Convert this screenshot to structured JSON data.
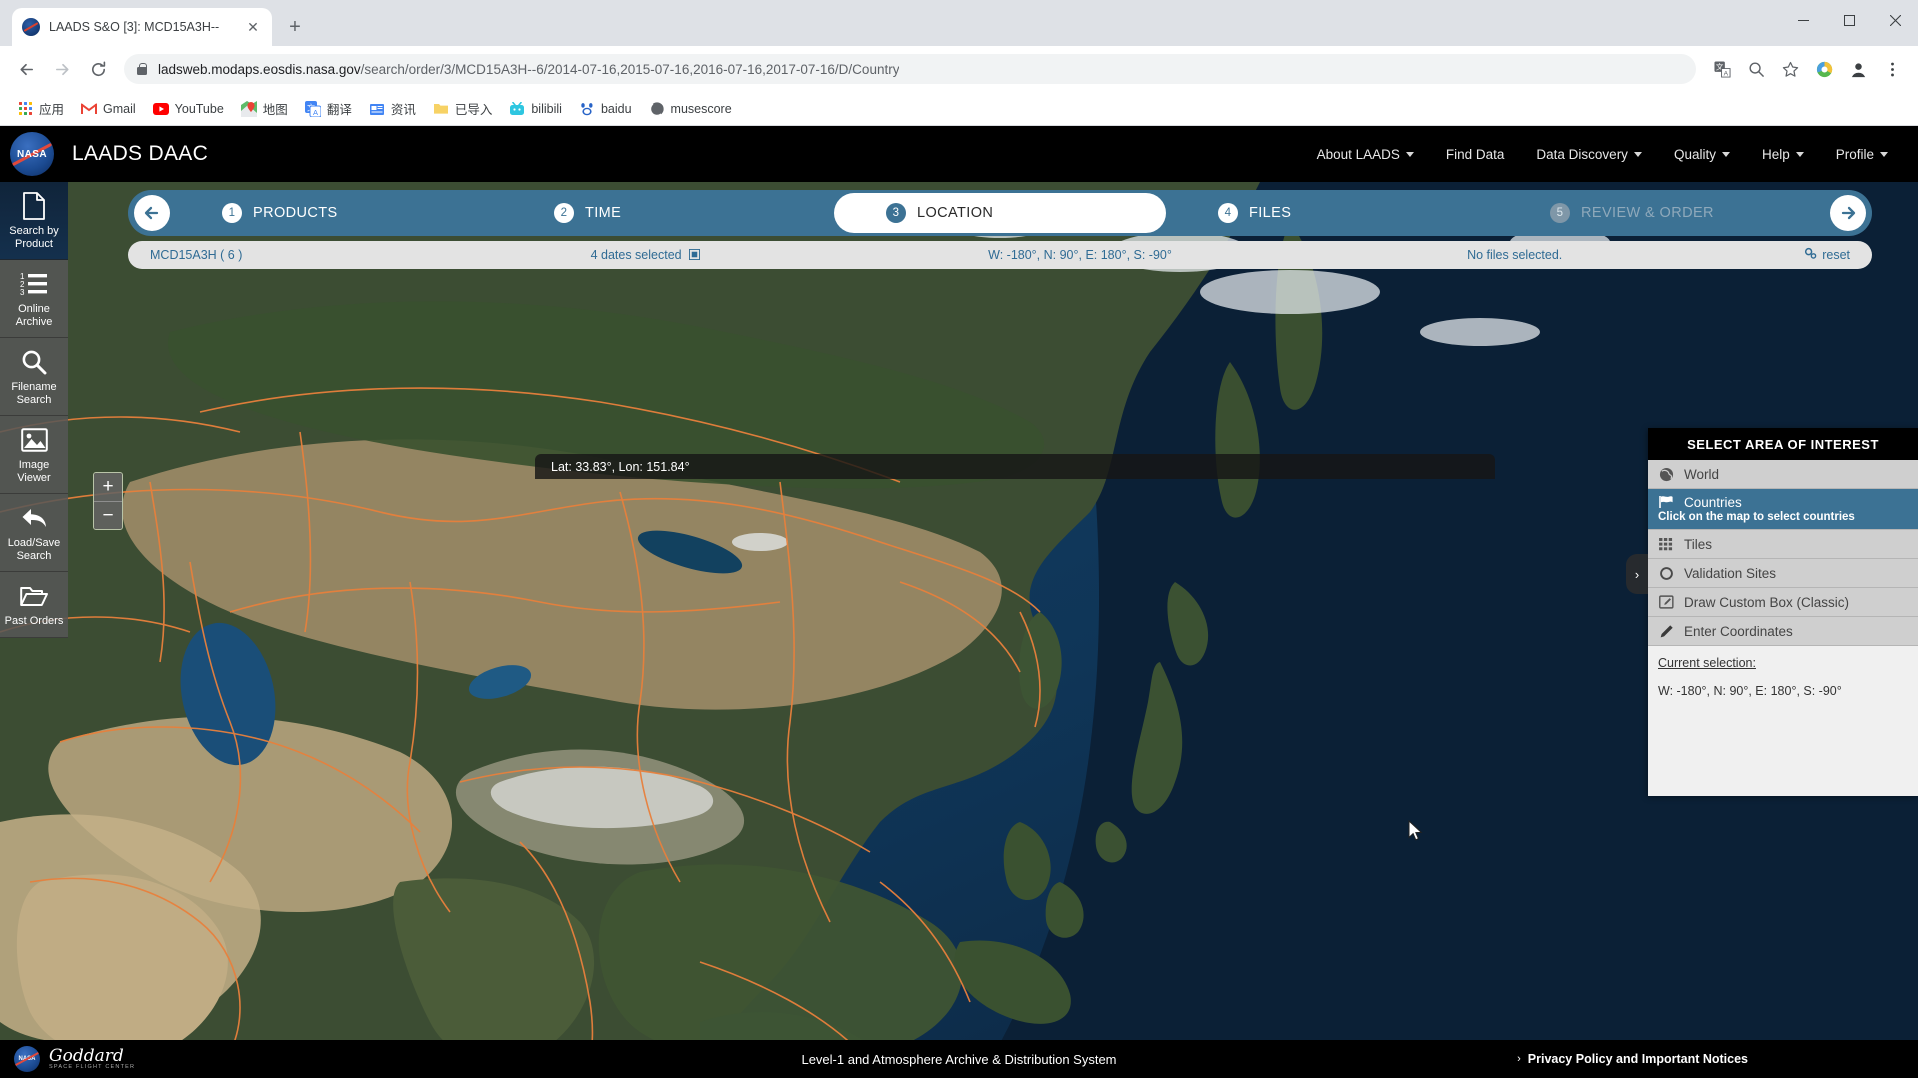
{
  "browser": {
    "tab": {
      "title": "LAADS S&O [3]: MCD15A3H--",
      "favicon": "nasa-meatball-icon",
      "close": "✕"
    },
    "new_tab": "+",
    "window_controls": {
      "minimize": "–",
      "maximize": "❐",
      "close": "✕"
    },
    "nav": {
      "back": "←",
      "forward": "→",
      "reload": "⟳"
    },
    "omnibox": {
      "host": "ladsweb.modaps.eosdis.nasa.gov",
      "path": "/search/order/3/MCD15A3H--6/2014-07-16,2015-07-16,2016-07-16,2017-07-16/D/Country",
      "full_url": "ladsweb.modaps.eosdis.nasa.gov/search/order/3/MCD15A3H--6/2014-07-16,2015-07-16,2016-07-16,2017-07-16/D/Country",
      "lock_icon": "lock-icon",
      "actions": [
        "translate-icon",
        "zoom-icon",
        "bookmark-star-icon"
      ]
    },
    "toolbar_right": {
      "extension": "idm-extension-icon",
      "profile": "profile-avatar-icon",
      "menu": "three-dot-menu-icon"
    },
    "bookmarks": [
      {
        "label": "应用",
        "icon": "apps-grid-icon"
      },
      {
        "label": "Gmail",
        "icon": "gmail-icon"
      },
      {
        "label": "YouTube",
        "icon": "youtube-icon"
      },
      {
        "label": "地图",
        "icon": "google-maps-icon"
      },
      {
        "label": "翻译",
        "icon": "google-translate-icon"
      },
      {
        "label": "资讯",
        "icon": "google-news-icon"
      },
      {
        "label": "已导入",
        "icon": "folder-icon"
      },
      {
        "label": "bilibili",
        "icon": "bilibili-icon"
      },
      {
        "label": "baidu",
        "icon": "baidu-icon"
      },
      {
        "label": "musescore",
        "icon": "musescore-icon"
      }
    ]
  },
  "header": {
    "logo": "nasa-meatball-icon",
    "brand": "LAADS DAAC",
    "nav": [
      {
        "label": "About LAADS",
        "caret": true
      },
      {
        "label": "Find Data",
        "caret": false
      },
      {
        "label": "Data Discovery",
        "caret": true
      },
      {
        "label": "Quality",
        "caret": true
      },
      {
        "label": "Help",
        "caret": true
      },
      {
        "label": "Profile",
        "caret": true
      }
    ]
  },
  "sidebar": {
    "items": [
      {
        "label": "Search by Product",
        "icon": "document-icon",
        "active": true
      },
      {
        "label": "Online Archive",
        "icon": "numbered-list-icon",
        "active": false
      },
      {
        "label": "Filename Search",
        "icon": "magnifier-icon",
        "active": false
      },
      {
        "label": "Image Viewer",
        "icon": "image-icon",
        "active": false
      },
      {
        "label": "Load/Save Search",
        "icon": "undo-arrow-icon",
        "active": false
      },
      {
        "label": "Past Orders",
        "icon": "folder-open-icon",
        "active": false
      }
    ]
  },
  "wizard": {
    "back_arrow": "←",
    "forward_arrow": "→",
    "steps": [
      {
        "num": "1",
        "label": "PRODUCTS",
        "state": "done"
      },
      {
        "num": "2",
        "label": "TIME",
        "state": "done"
      },
      {
        "num": "3",
        "label": "LOCATION",
        "state": "active"
      },
      {
        "num": "4",
        "label": "FILES",
        "state": "done"
      },
      {
        "num": "5",
        "label": "REVIEW & ORDER",
        "state": "disabled"
      }
    ]
  },
  "summary": {
    "product": "MCD15A3H ( 6 )",
    "dates": "4 dates selected",
    "dates_icon": "calendar-expand-icon",
    "location": "W: -180°, N: 90°, E: 180°, S: -90°",
    "files": "No files selected.",
    "reset": "reset",
    "reset_icon": "gears-icon"
  },
  "map": {
    "latlon_readout": "Lat: 33.83°, Lon: 151.84°",
    "zoom_in": "+",
    "zoom_out": "−",
    "panel_toggle": "›",
    "colors": {
      "ocean_deep": "#0d2742",
      "ocean_mid": "#14466e",
      "land_green": "#3d4f33",
      "land_desert": "#b4a07c",
      "border": "#e8803c"
    }
  },
  "aoi": {
    "title": "SELECT AREA OF INTEREST",
    "options": [
      {
        "label": "World",
        "icon": "globe-icon",
        "selected": false
      },
      {
        "label": "Countries",
        "icon": "flag-icon",
        "selected": true,
        "hint": "Click on the map to select countries"
      },
      {
        "label": "Tiles",
        "icon": "grid-icon",
        "selected": false
      },
      {
        "label": "Validation Sites",
        "icon": "circle-icon",
        "selected": false
      },
      {
        "label": "Draw Custom Box (Classic)",
        "icon": "draw-box-icon",
        "selected": false
      },
      {
        "label": "Enter Coordinates",
        "icon": "pencil-icon",
        "selected": false
      }
    ],
    "current_selection_label": "Current selection:",
    "current_selection_value": "W: -180°, N: 90°, E: 180°, S: -90°"
  },
  "footer": {
    "nasa": "NASA",
    "goddard_signature": "Goddard",
    "goddard_sub": "SPACE FLIGHT CENTER",
    "center_text": "Level-1 and Atmosphere Archive & Distribution System",
    "privacy_link": "Privacy Policy and Important Notices",
    "privacy_caret": "›"
  }
}
